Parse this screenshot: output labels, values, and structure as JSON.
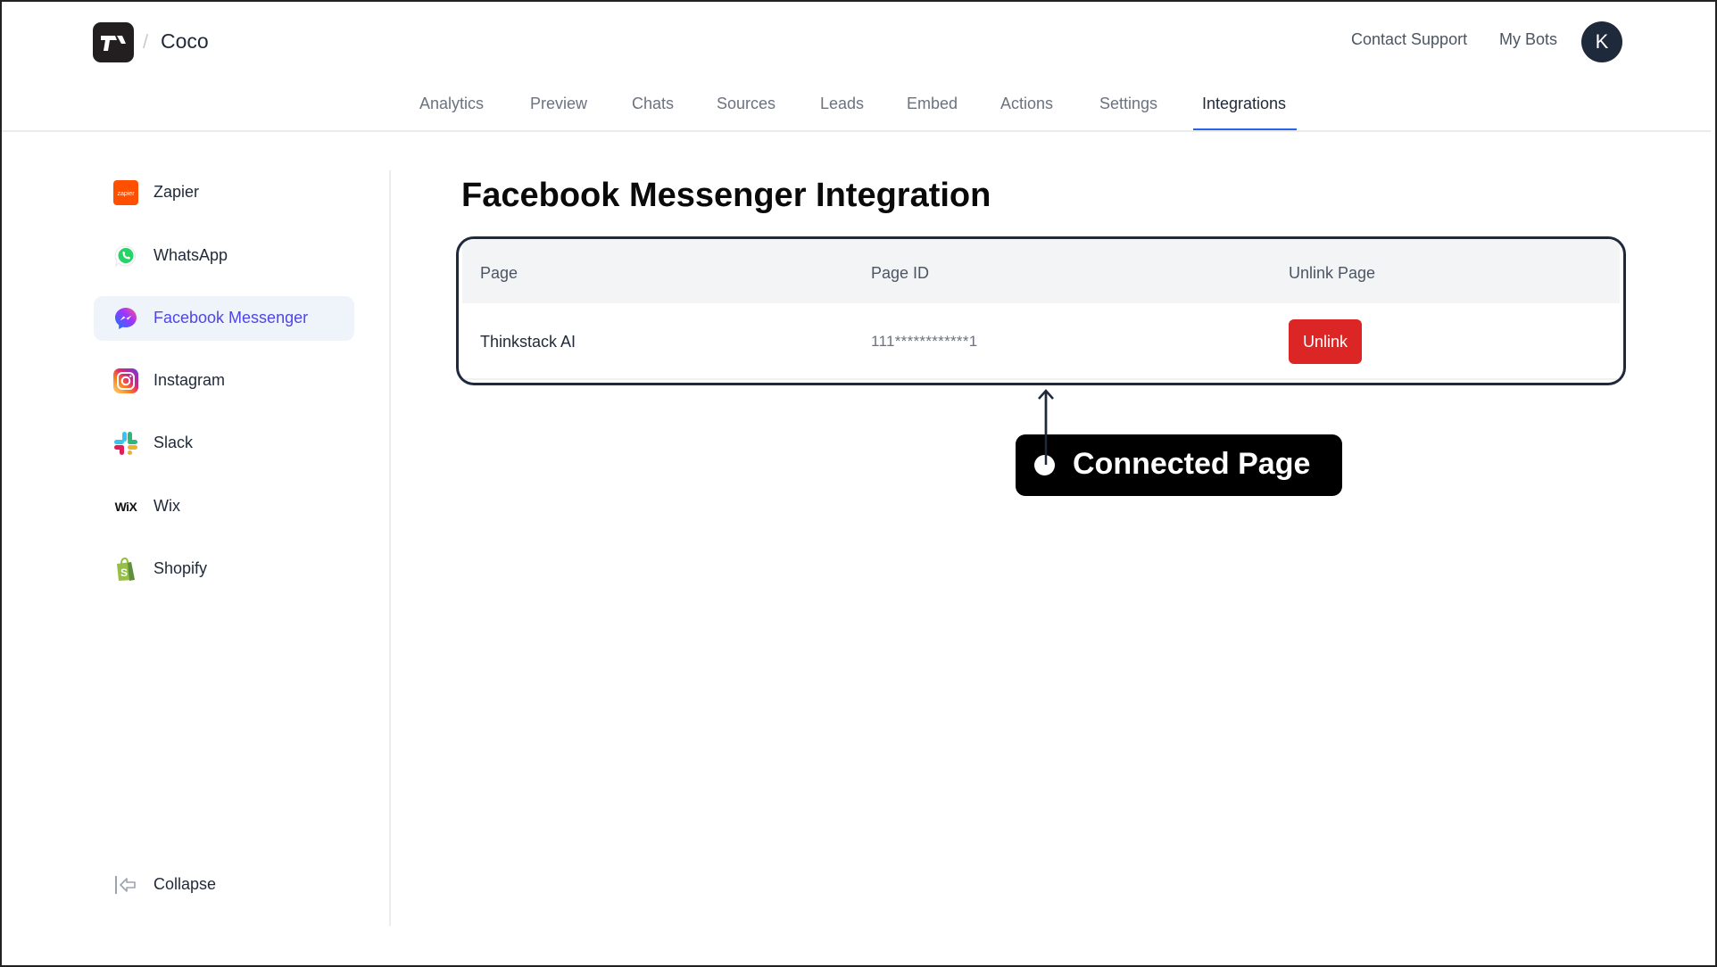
{
  "header": {
    "logo_icon": "thinkstack-logo-icon",
    "breadcrumb_separator": "/",
    "bot_name": "Coco",
    "contact_support": "Contact Support",
    "my_bots": "My Bots",
    "avatar_initial": "K"
  },
  "tabs": [
    {
      "label": "Analytics",
      "active": false
    },
    {
      "label": "Preview",
      "active": false
    },
    {
      "label": "Chats",
      "active": false
    },
    {
      "label": "Sources",
      "active": false
    },
    {
      "label": "Leads",
      "active": false
    },
    {
      "label": "Embed",
      "active": false
    },
    {
      "label": "Actions",
      "active": false
    },
    {
      "label": "Settings",
      "active": false
    },
    {
      "label": "Integrations",
      "active": true
    }
  ],
  "sidebar": {
    "items": [
      {
        "label": "Zapier",
        "icon": "zapier-icon",
        "active": false
      },
      {
        "label": "WhatsApp",
        "icon": "whatsapp-icon",
        "active": false
      },
      {
        "label": "Facebook Messenger",
        "icon": "messenger-icon",
        "active": true
      },
      {
        "label": "Instagram",
        "icon": "instagram-icon",
        "active": false
      },
      {
        "label": "Slack",
        "icon": "slack-icon",
        "active": false
      },
      {
        "label": "Wix",
        "icon": "wix-icon",
        "active": false
      },
      {
        "label": "Shopify",
        "icon": "shopify-icon",
        "active": false
      }
    ],
    "collapse_label": "Collapse",
    "zapier_icon_text": "zapier",
    "wix_icon_text": "WiX"
  },
  "main": {
    "title": "Facebook Messenger Integration",
    "table": {
      "columns": [
        "Page",
        "Page ID",
        "Unlink Page"
      ],
      "rows": [
        {
          "page": "Thinkstack AI",
          "page_id": "111************1",
          "action_label": "Unlink"
        }
      ]
    }
  },
  "annotation": {
    "label": "Connected Page"
  },
  "colors": {
    "accent": "#2563eb",
    "active_sidebar_text": "#4f46e5",
    "active_sidebar_bg": "#eff3fa",
    "danger": "#dc2626",
    "annotation_border": "#1e293b"
  }
}
